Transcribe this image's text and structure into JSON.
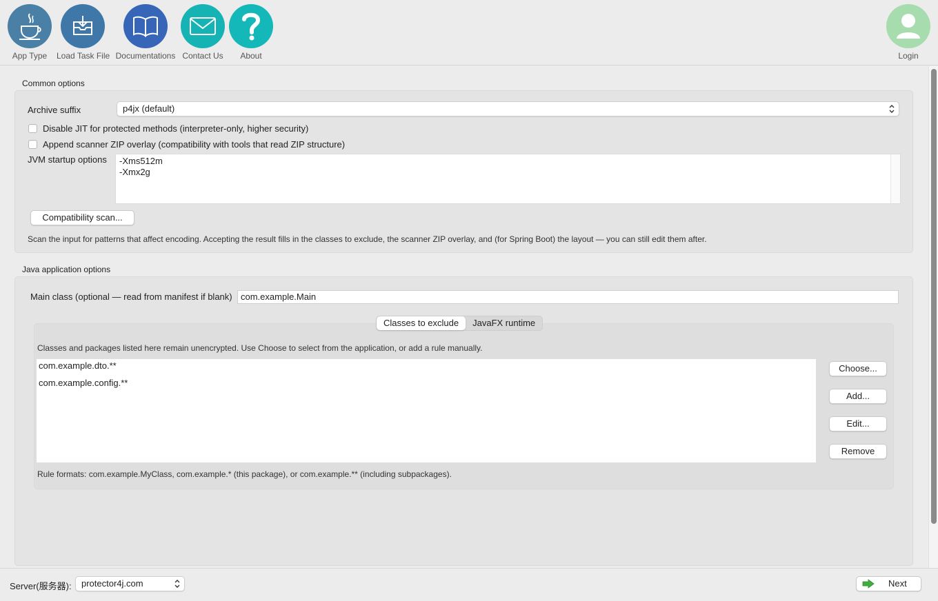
{
  "toolbar": {
    "app_type": "App Type",
    "load_task": "Load Task File",
    "docs": "Documentations",
    "contact": "Contact Us",
    "about": "About",
    "login": "Login"
  },
  "common": {
    "title": "Common options",
    "archive_suffix_label": "Archive suffix",
    "archive_suffix_value": "p4jx (default)",
    "disable_jit": "Disable JIT for protected methods (interpreter-only, higher security)",
    "append_zip": "Append scanner ZIP overlay (compatibility with tools that read ZIP structure)",
    "jvm_label": "JVM startup options",
    "jvm_options": [
      "-Xms512m",
      "-Xmx2g"
    ],
    "scan_button": "Compatibility scan...",
    "scan_help": "Scan the input for patterns that affect encoding. Accepting the result fills in the classes to exclude, the scanner ZIP overlay, and (for Spring Boot) the layout — you can still edit them after."
  },
  "java": {
    "title": "Java application options",
    "main_class_label": "Main class (optional — read from manifest if blank)",
    "main_class_value": "com.example.Main",
    "tabs": [
      "Classes to exclude",
      "JavaFX runtime"
    ],
    "exclude_help": "Classes and packages listed here remain unencrypted. Use Choose to select from the application, or add a rule manually.",
    "excludes": [
      "com.example.dto.**",
      "com.example.config.**"
    ],
    "buttons": {
      "choose": "Choose...",
      "add": "Add...",
      "edit": "Edit...",
      "remove": "Remove"
    },
    "rule_formats": "Rule formats: com.example.MyClass, com.example.* (this package), or com.example.** (including subpackages)."
  },
  "footer": {
    "server_label": "Server(服务器):",
    "server_value": "protector4j.com",
    "next": "Next"
  },
  "colors": {
    "app_type": "#4a7fa6",
    "load_task": "#3f78a8",
    "docs": "#3766b8",
    "contact": "#16b3b5",
    "about": "#14b8b8",
    "login": "#a6dcae"
  }
}
